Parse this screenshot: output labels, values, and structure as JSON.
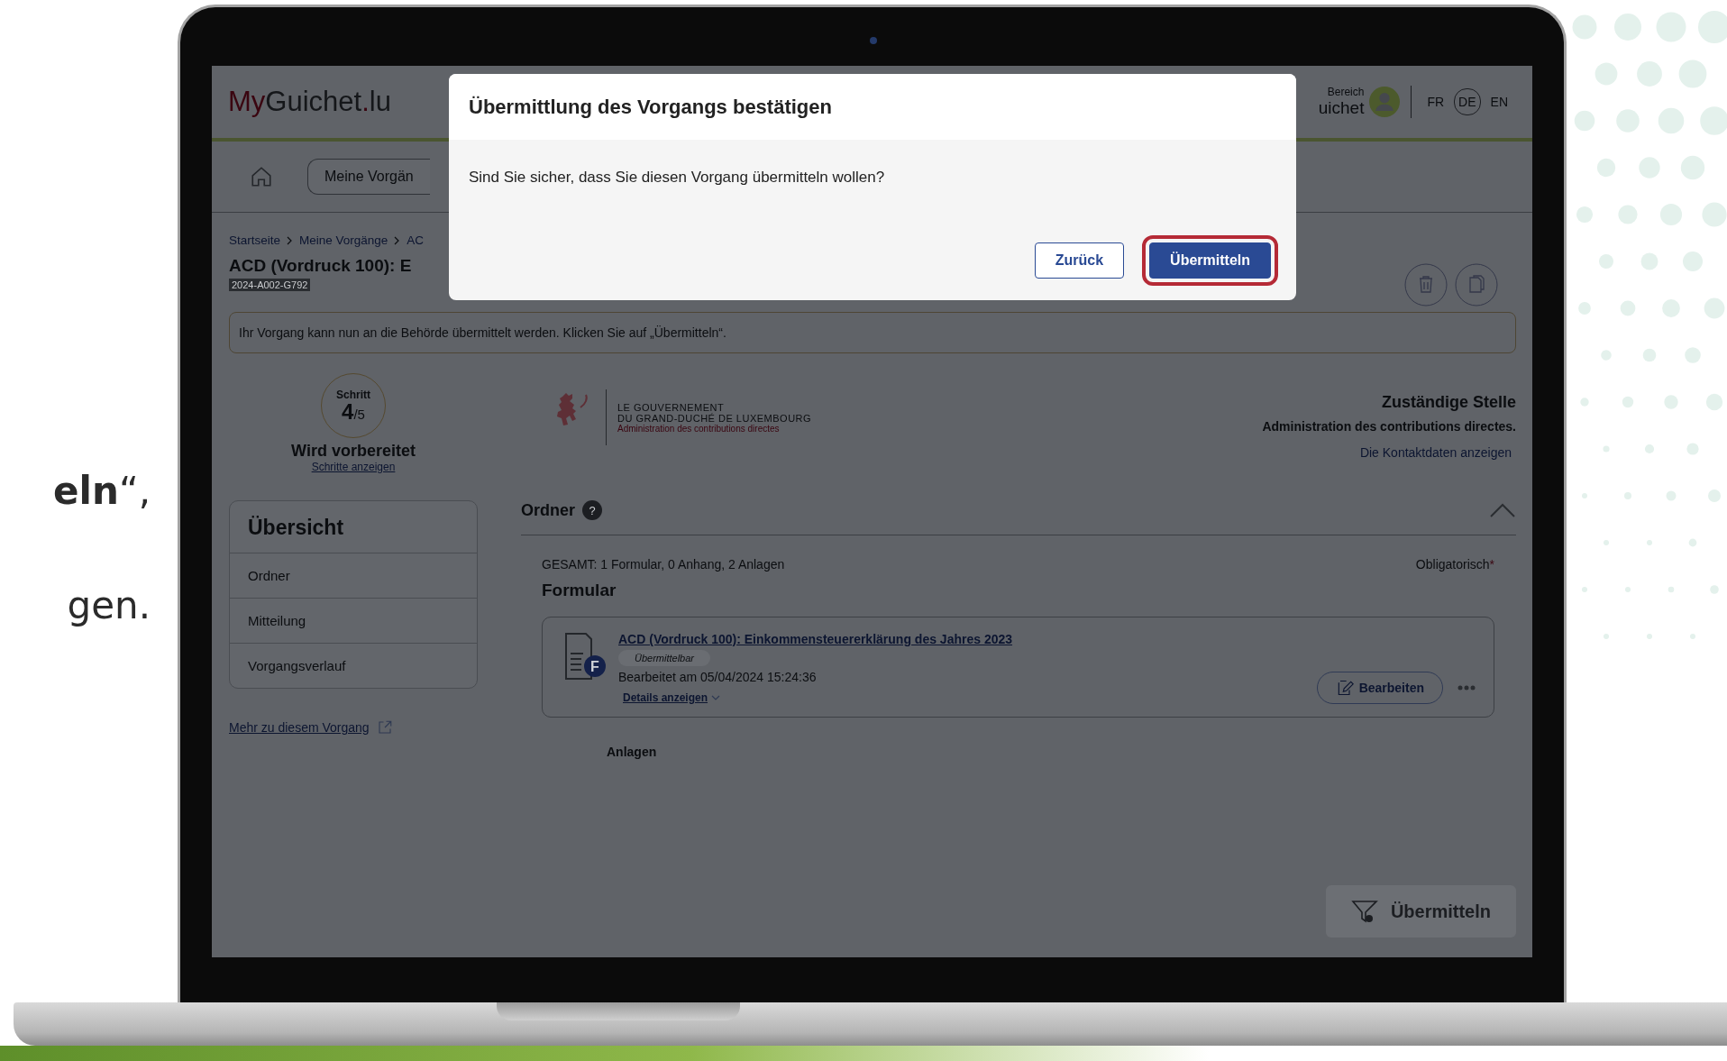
{
  "side_text": [
    "**eln**“,",
    "gen."
  ],
  "header": {
    "logo": [
      "My",
      "Guichet",
      ".",
      "lu"
    ],
    "account": {
      "label": "Bereich",
      "name": "uichet"
    },
    "languages": [
      {
        "label": "FR",
        "selected": false
      },
      {
        "label": "DE",
        "selected": true
      },
      {
        "label": "EN",
        "selected": false
      }
    ]
  },
  "nav": {
    "tab": "Meine Vorgän"
  },
  "breadcrumb": [
    "Startseite",
    "Meine Vorgänge",
    "AC"
  ],
  "title": "ACD (Vordruck 100): E",
  "reference": "2024-A002-G792",
  "notice": "Ihr Vorgang kann nun an die Behörde übermittelt werden. Klicken Sie auf „Übermitteln“.",
  "step": {
    "label": "Schritt",
    "current": "4",
    "total": "/5",
    "status": "Wird vorbereitet",
    "link": "Schritte anzeigen"
  },
  "authority": {
    "logo_lines": [
      "LE GOUVERNEMENT",
      "DU GRAND-DUCHÉ DE LUXEMBOURG",
      "Administration des contributions directes"
    ],
    "heading": "Zuständige Stelle",
    "name": "Administration des contributions directes.",
    "link": "Die Kontaktdaten anzeigen"
  },
  "overview": {
    "title": "Übersicht",
    "items": [
      "Ordner",
      "Mitteilung",
      "Vorgangsverlauf"
    ]
  },
  "more_link": "Mehr zu diesem Vorgang",
  "folder": {
    "title": "Ordner",
    "help_icon": "?",
    "expanded": true,
    "total": "GESAMT: 1 Formular, 0 Anhang, 2 Anlagen",
    "required": "Obligatorisch",
    "required_mark": "*",
    "section": "Formular",
    "form": {
      "icon_letter": "F",
      "title": "ACD (Vordruck 100): Einkommensteuererklärung des Jahres 2023",
      "status": "Übermittelbar",
      "edited": "Bearbeitet am 05/04/2024 15:24:36",
      "details": "Details anzeigen",
      "edit_button": "Bearbeiten"
    },
    "attachments": "Anlagen"
  },
  "submit_button": {
    "label": "Übermitteln",
    "disabled": true
  },
  "dialog": {
    "title": "Übermittlung des Vorgangs bestätigen",
    "message": "Sind Sie sicher, dass Sie diesen Vorgang übermitteln wollen?",
    "buttons": [
      {
        "label": "Zurück",
        "kind": "secondary",
        "highlighted": false
      },
      {
        "label": "Übermitteln",
        "kind": "primary",
        "highlighted": true
      }
    ]
  }
}
